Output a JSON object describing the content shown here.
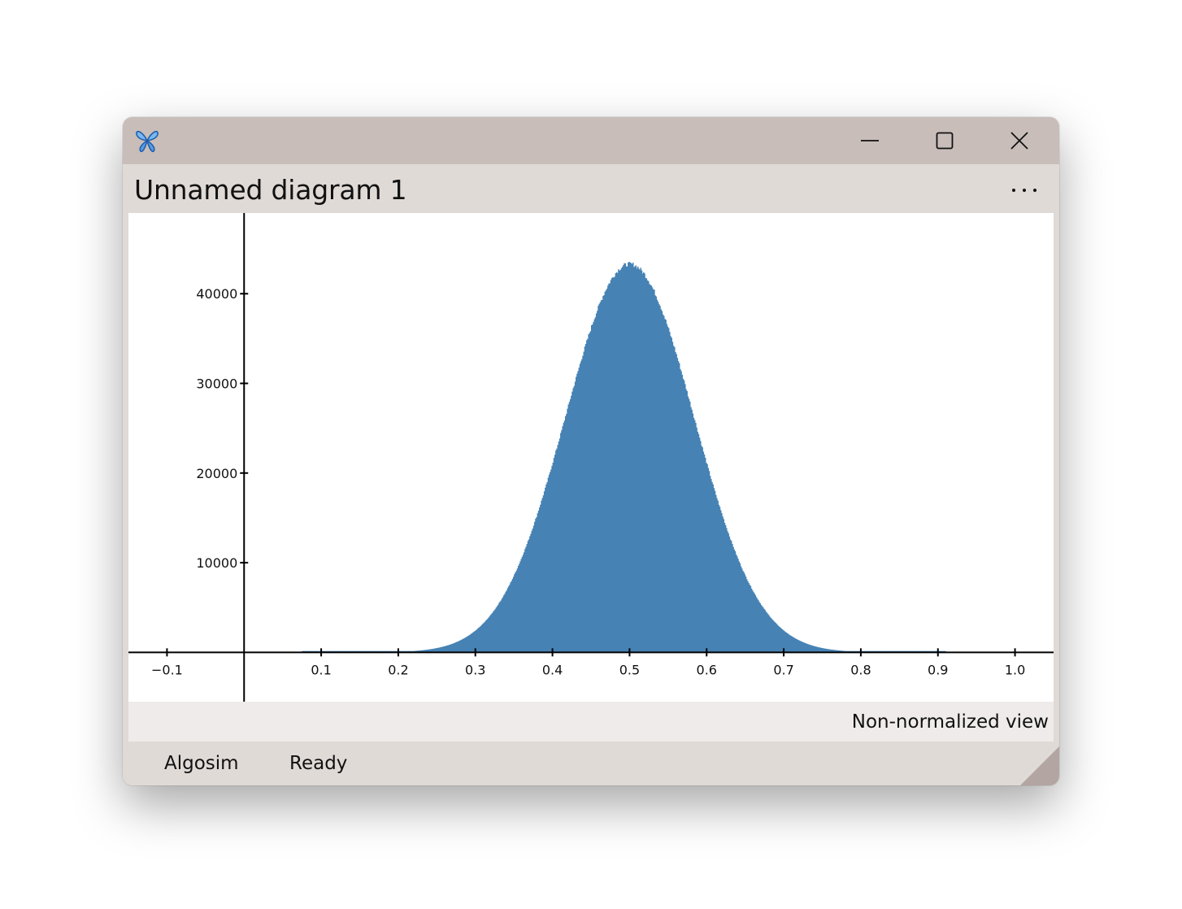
{
  "window": {
    "title": "Unnamed diagram 1",
    "more_menu_glyph": "···"
  },
  "icons": {
    "app": "butterfly-icon",
    "minimize": "minimize-icon",
    "maximize": "maximize-icon",
    "close": "close-icon",
    "more": "more-horizontal-icon",
    "resize": "resize-grip-icon"
  },
  "view_mode": "Non-normalized view",
  "status": {
    "app_name": "Algosim",
    "state": "Ready"
  },
  "colors": {
    "titlebar": "#c8bdb9",
    "chrome": "#e0dad7",
    "bar_fill": "#4682b4",
    "axis": "#000000"
  },
  "chart_data": {
    "type": "bar",
    "title": "",
    "xlabel": "",
    "ylabel": "",
    "xlim": [
      -0.15,
      1.05
    ],
    "ylim": [
      -5500,
      49000
    ],
    "x_ticks": [
      -0.1,
      0.1,
      0.2,
      0.3,
      0.4,
      0.5,
      0.6,
      0.7,
      0.8,
      0.9,
      1.0
    ],
    "x_tick_labels": [
      "−0.1",
      "0.1",
      "0.2",
      "0.3",
      "0.4",
      "0.5",
      "0.6",
      "0.7",
      "0.8",
      "0.9",
      "1.0"
    ],
    "y_ticks": [
      10000,
      20000,
      30000,
      40000
    ],
    "y_tick_labels": [
      "10000",
      "20000",
      "30000",
      "40000"
    ],
    "grid": false,
    "bins": {
      "x_min": 0.075,
      "x_max": 0.91,
      "bin_width": 0.00125
    },
    "approx_distribution": {
      "peak_x": 0.5,
      "peak_count": 43300,
      "std_dev": 0.0833
    }
  }
}
